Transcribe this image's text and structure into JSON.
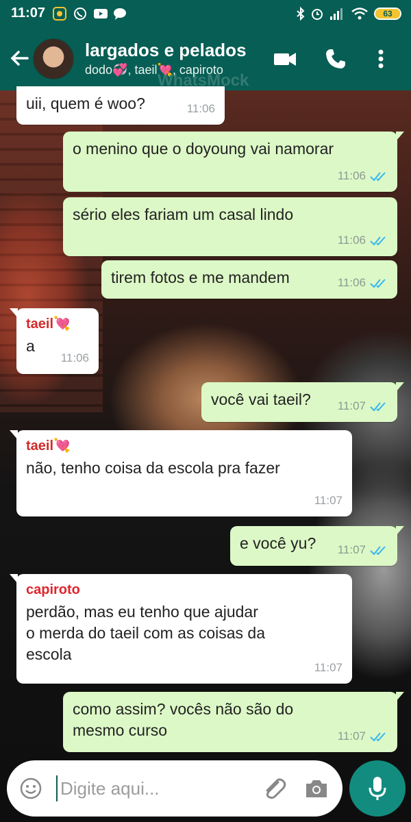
{
  "statusbar": {
    "time": "11:07",
    "battery": "63"
  },
  "header": {
    "group_name": "largados e pelados",
    "members": "dodo💞, taeil💘, capiroto",
    "watermark": "WhatsMock"
  },
  "messages": [
    {
      "dir": "in",
      "text": "uii, quem é woo?",
      "time": "11:06"
    },
    {
      "dir": "out",
      "text": "o menino que o doyoung vai namorar",
      "time": "11:06"
    },
    {
      "dir": "out",
      "text": "sério eles fariam um casal lindo",
      "time": "11:06"
    },
    {
      "dir": "out",
      "text": "tirem fotos e me mandem",
      "time": "11:06"
    },
    {
      "dir": "in",
      "sender": "taeil💘",
      "text": "a",
      "time": "11:06"
    },
    {
      "dir": "out",
      "text": "você vai taeil?",
      "time": "11:07"
    },
    {
      "dir": "in",
      "sender": "taeil💘",
      "text": "não, tenho coisa da escola pra fazer",
      "time": "11:07"
    },
    {
      "dir": "out",
      "text": "e você yu?",
      "time": "11:07"
    },
    {
      "dir": "in",
      "sender": "capiroto",
      "text_lines": [
        "perdão, mas eu tenho que ajudar",
        "o merda do taeil com as coisas da",
        "escola"
      ],
      "time": "11:07"
    },
    {
      "dir": "out",
      "text_lines": [
        "como assim? vocês não são do",
        "mesmo curso"
      ],
      "time": "11:07"
    }
  ],
  "input": {
    "placeholder": "Digite aqui..."
  },
  "colors": {
    "header": "#075e54",
    "outgoing": "#dcf8c6",
    "incoming": "#ffffff",
    "read_tick": "#34b7f1",
    "mic_button": "#128c7e"
  }
}
